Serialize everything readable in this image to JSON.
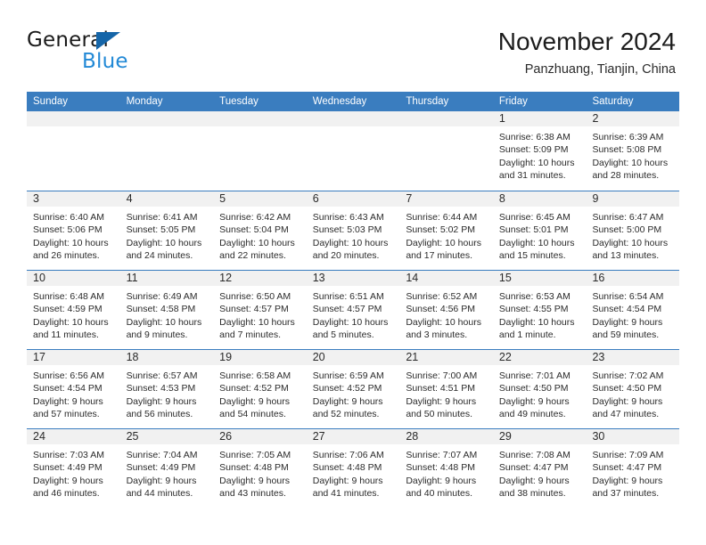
{
  "brand": {
    "name_top": "General",
    "name_bottom": "Blue",
    "triangle_color": "#1565a8",
    "blue_color": "#2289d6"
  },
  "header": {
    "title": "November 2024",
    "subtitle": "Panzhuang, Tianjin, China"
  },
  "theme": {
    "header_blue": "#3a7dbf",
    "band_gray": "#f1f1f1",
    "text": "#2b2b2b"
  },
  "weekdays": [
    "Sunday",
    "Monday",
    "Tuesday",
    "Wednesday",
    "Thursday",
    "Friday",
    "Saturday"
  ],
  "weeks": [
    [
      {
        "day": "",
        "lines": []
      },
      {
        "day": "",
        "lines": []
      },
      {
        "day": "",
        "lines": []
      },
      {
        "day": "",
        "lines": []
      },
      {
        "day": "",
        "lines": []
      },
      {
        "day": "1",
        "lines": [
          "Sunrise: 6:38 AM",
          "Sunset: 5:09 PM",
          "Daylight: 10 hours",
          "and 31 minutes."
        ]
      },
      {
        "day": "2",
        "lines": [
          "Sunrise: 6:39 AM",
          "Sunset: 5:08 PM",
          "Daylight: 10 hours",
          "and 28 minutes."
        ]
      }
    ],
    [
      {
        "day": "3",
        "lines": [
          "Sunrise: 6:40 AM",
          "Sunset: 5:06 PM",
          "Daylight: 10 hours",
          "and 26 minutes."
        ]
      },
      {
        "day": "4",
        "lines": [
          "Sunrise: 6:41 AM",
          "Sunset: 5:05 PM",
          "Daylight: 10 hours",
          "and 24 minutes."
        ]
      },
      {
        "day": "5",
        "lines": [
          "Sunrise: 6:42 AM",
          "Sunset: 5:04 PM",
          "Daylight: 10 hours",
          "and 22 minutes."
        ]
      },
      {
        "day": "6",
        "lines": [
          "Sunrise: 6:43 AM",
          "Sunset: 5:03 PM",
          "Daylight: 10 hours",
          "and 20 minutes."
        ]
      },
      {
        "day": "7",
        "lines": [
          "Sunrise: 6:44 AM",
          "Sunset: 5:02 PM",
          "Daylight: 10 hours",
          "and 17 minutes."
        ]
      },
      {
        "day": "8",
        "lines": [
          "Sunrise: 6:45 AM",
          "Sunset: 5:01 PM",
          "Daylight: 10 hours",
          "and 15 minutes."
        ]
      },
      {
        "day": "9",
        "lines": [
          "Sunrise: 6:47 AM",
          "Sunset: 5:00 PM",
          "Daylight: 10 hours",
          "and 13 minutes."
        ]
      }
    ],
    [
      {
        "day": "10",
        "lines": [
          "Sunrise: 6:48 AM",
          "Sunset: 4:59 PM",
          "Daylight: 10 hours",
          "and 11 minutes."
        ]
      },
      {
        "day": "11",
        "lines": [
          "Sunrise: 6:49 AM",
          "Sunset: 4:58 PM",
          "Daylight: 10 hours",
          "and 9 minutes."
        ]
      },
      {
        "day": "12",
        "lines": [
          "Sunrise: 6:50 AM",
          "Sunset: 4:57 PM",
          "Daylight: 10 hours",
          "and 7 minutes."
        ]
      },
      {
        "day": "13",
        "lines": [
          "Sunrise: 6:51 AM",
          "Sunset: 4:57 PM",
          "Daylight: 10 hours",
          "and 5 minutes."
        ]
      },
      {
        "day": "14",
        "lines": [
          "Sunrise: 6:52 AM",
          "Sunset: 4:56 PM",
          "Daylight: 10 hours",
          "and 3 minutes."
        ]
      },
      {
        "day": "15",
        "lines": [
          "Sunrise: 6:53 AM",
          "Sunset: 4:55 PM",
          "Daylight: 10 hours",
          "and 1 minute."
        ]
      },
      {
        "day": "16",
        "lines": [
          "Sunrise: 6:54 AM",
          "Sunset: 4:54 PM",
          "Daylight: 9 hours",
          "and 59 minutes."
        ]
      }
    ],
    [
      {
        "day": "17",
        "lines": [
          "Sunrise: 6:56 AM",
          "Sunset: 4:54 PM",
          "Daylight: 9 hours",
          "and 57 minutes."
        ]
      },
      {
        "day": "18",
        "lines": [
          "Sunrise: 6:57 AM",
          "Sunset: 4:53 PM",
          "Daylight: 9 hours",
          "and 56 minutes."
        ]
      },
      {
        "day": "19",
        "lines": [
          "Sunrise: 6:58 AM",
          "Sunset: 4:52 PM",
          "Daylight: 9 hours",
          "and 54 minutes."
        ]
      },
      {
        "day": "20",
        "lines": [
          "Sunrise: 6:59 AM",
          "Sunset: 4:52 PM",
          "Daylight: 9 hours",
          "and 52 minutes."
        ]
      },
      {
        "day": "21",
        "lines": [
          "Sunrise: 7:00 AM",
          "Sunset: 4:51 PM",
          "Daylight: 9 hours",
          "and 50 minutes."
        ]
      },
      {
        "day": "22",
        "lines": [
          "Sunrise: 7:01 AM",
          "Sunset: 4:50 PM",
          "Daylight: 9 hours",
          "and 49 minutes."
        ]
      },
      {
        "day": "23",
        "lines": [
          "Sunrise: 7:02 AM",
          "Sunset: 4:50 PM",
          "Daylight: 9 hours",
          "and 47 minutes."
        ]
      }
    ],
    [
      {
        "day": "24",
        "lines": [
          "Sunrise: 7:03 AM",
          "Sunset: 4:49 PM",
          "Daylight: 9 hours",
          "and 46 minutes."
        ]
      },
      {
        "day": "25",
        "lines": [
          "Sunrise: 7:04 AM",
          "Sunset: 4:49 PM",
          "Daylight: 9 hours",
          "and 44 minutes."
        ]
      },
      {
        "day": "26",
        "lines": [
          "Sunrise: 7:05 AM",
          "Sunset: 4:48 PM",
          "Daylight: 9 hours",
          "and 43 minutes."
        ]
      },
      {
        "day": "27",
        "lines": [
          "Sunrise: 7:06 AM",
          "Sunset: 4:48 PM",
          "Daylight: 9 hours",
          "and 41 minutes."
        ]
      },
      {
        "day": "28",
        "lines": [
          "Sunrise: 7:07 AM",
          "Sunset: 4:48 PM",
          "Daylight: 9 hours",
          "and 40 minutes."
        ]
      },
      {
        "day": "29",
        "lines": [
          "Sunrise: 7:08 AM",
          "Sunset: 4:47 PM",
          "Daylight: 9 hours",
          "and 38 minutes."
        ]
      },
      {
        "day": "30",
        "lines": [
          "Sunrise: 7:09 AM",
          "Sunset: 4:47 PM",
          "Daylight: 9 hours",
          "and 37 minutes."
        ]
      }
    ]
  ]
}
